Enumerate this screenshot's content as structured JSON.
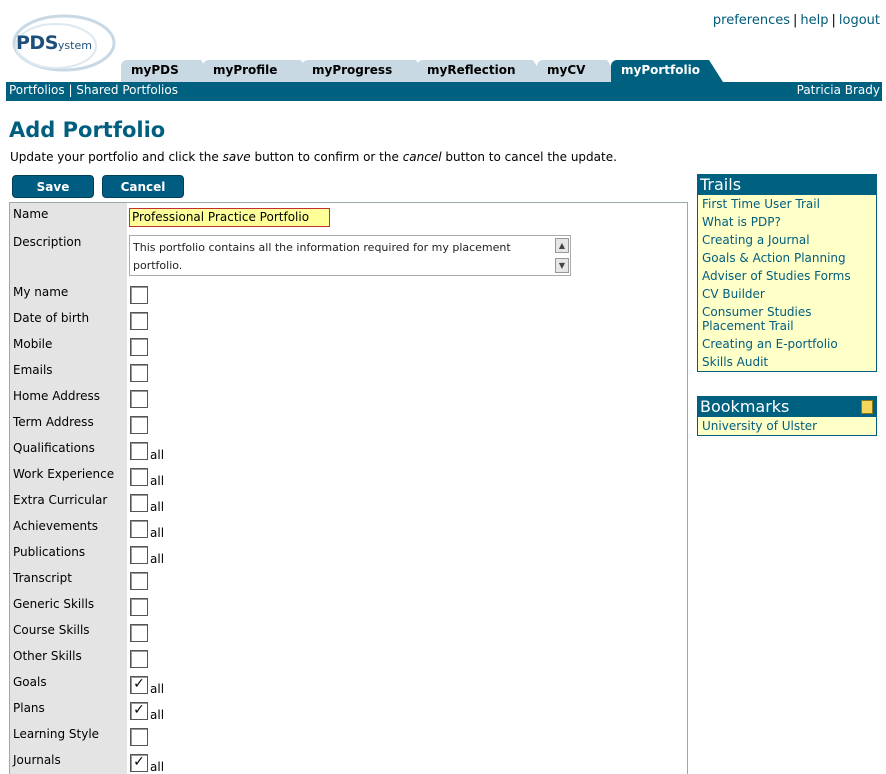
{
  "header": {
    "logo_main": "PDS",
    "logo_sub": "ystem",
    "links": [
      "preferences",
      "help",
      "logout"
    ]
  },
  "tabs": [
    "myPDS",
    "myProfile",
    "myProgress",
    "myReflection",
    "myCV",
    "myPortfolio"
  ],
  "navbar": {
    "left_links": [
      "Portfolios",
      "Shared Portfolios"
    ],
    "user": "Patricia Brady"
  },
  "page": {
    "title": "Add Portfolio",
    "intro_pre": "Update your portfolio and click the ",
    "intro_save": "save",
    "intro_mid": " button to confirm or the ",
    "intro_cancel": "cancel",
    "intro_post": " button to cancel the update."
  },
  "buttons": {
    "save": "Save",
    "cancel": "Cancel"
  },
  "form": {
    "name_label": "Name",
    "name_value": "Professional Practice Portfolio",
    "description_label": "Description",
    "description_value": "This portfolio contains all the information required for my placement portfolio.",
    "all_label": "all",
    "fields": [
      {
        "label": "My name",
        "checked": false,
        "all": false
      },
      {
        "label": "Date of birth",
        "checked": false,
        "all": false
      },
      {
        "label": "Mobile",
        "checked": false,
        "all": false
      },
      {
        "label": "Emails",
        "checked": false,
        "all": false
      },
      {
        "label": "Home Address",
        "checked": false,
        "all": false
      },
      {
        "label": "Term Address",
        "checked": false,
        "all": false
      },
      {
        "label": "Qualifications",
        "checked": false,
        "all": true
      },
      {
        "label": "Work Experience",
        "checked": false,
        "all": true
      },
      {
        "label": "Extra Curricular",
        "checked": false,
        "all": true
      },
      {
        "label": "Achievements",
        "checked": false,
        "all": true
      },
      {
        "label": "Publications",
        "checked": false,
        "all": true
      },
      {
        "label": "Transcript",
        "checked": false,
        "all": false
      },
      {
        "label": "Generic Skills",
        "checked": false,
        "all": false
      },
      {
        "label": "Course Skills",
        "checked": false,
        "all": false
      },
      {
        "label": "Other Skills",
        "checked": false,
        "all": false
      },
      {
        "label": "Goals",
        "checked": true,
        "all": true
      },
      {
        "label": "Plans",
        "checked": true,
        "all": true
      },
      {
        "label": "Learning Style",
        "checked": false,
        "all": false
      },
      {
        "label": "Journals",
        "checked": true,
        "all": true
      }
    ]
  },
  "trails": {
    "title": "Trails",
    "items": [
      "First Time User Trail",
      "What is PDP?",
      "Creating a Journal",
      "Goals & Action Planning",
      "Adviser of Studies Forms",
      "CV Builder",
      "Consumer Studies Placement Trail",
      "Creating an E-portfolio",
      "Skills Audit"
    ]
  },
  "bookmarks": {
    "title": "Bookmarks",
    "items": [
      "University of Ulster"
    ]
  }
}
